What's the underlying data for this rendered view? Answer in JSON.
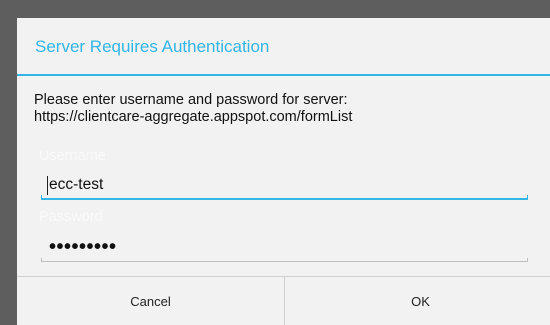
{
  "dialog": {
    "title": "Server Requires Authentication",
    "message_line1": "Please enter username and password for server:",
    "message_line2": "https://clientcare-aggregate.appspot.com/formList",
    "username": {
      "label": "Username",
      "value": "ecc-test"
    },
    "password": {
      "label": "Password",
      "masked_value": "•••••••••"
    },
    "buttons": {
      "cancel": "Cancel",
      "ok": "OK"
    }
  },
  "colors": {
    "accent": "#33b5e5",
    "dialog_background": "#f2f2f2",
    "backdrop": "#5e5e5e"
  }
}
